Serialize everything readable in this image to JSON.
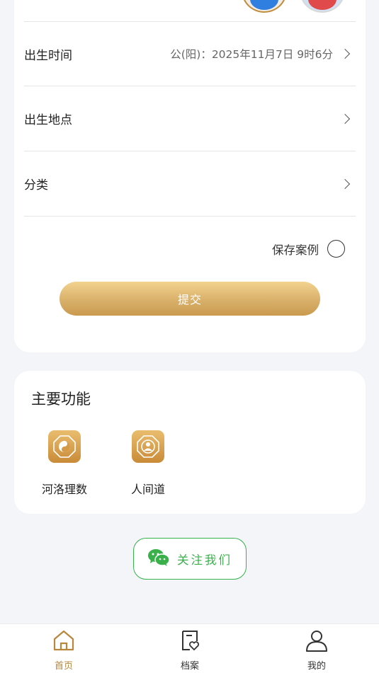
{
  "form": {
    "birth_time": {
      "label": "出生时间",
      "value": "公(阳)：2025年11月7日 9时6分"
    },
    "birth_place": {
      "label": "出生地点",
      "value": ""
    },
    "category": {
      "label": "分类",
      "value": ""
    },
    "save_case_label": "保存案例",
    "submit_label": "提交"
  },
  "features": {
    "title": "主要功能",
    "items": [
      {
        "label": "河洛理数",
        "icon": "yin-yang-icon"
      },
      {
        "label": "人间道",
        "icon": "person-bagua-icon"
      }
    ]
  },
  "follow": {
    "label": "关注我们",
    "icon": "wechat-icon"
  },
  "tabbar": {
    "items": [
      {
        "label": "首页",
        "icon": "home-icon",
        "active": true
      },
      {
        "label": "档案",
        "icon": "archive-heart-icon",
        "active": false
      },
      {
        "label": "我的",
        "icon": "user-icon",
        "active": false
      }
    ]
  },
  "colors": {
    "accent": "#c99a4f",
    "wechat_green": "#39b04a",
    "active_tab": "#b8873b"
  }
}
